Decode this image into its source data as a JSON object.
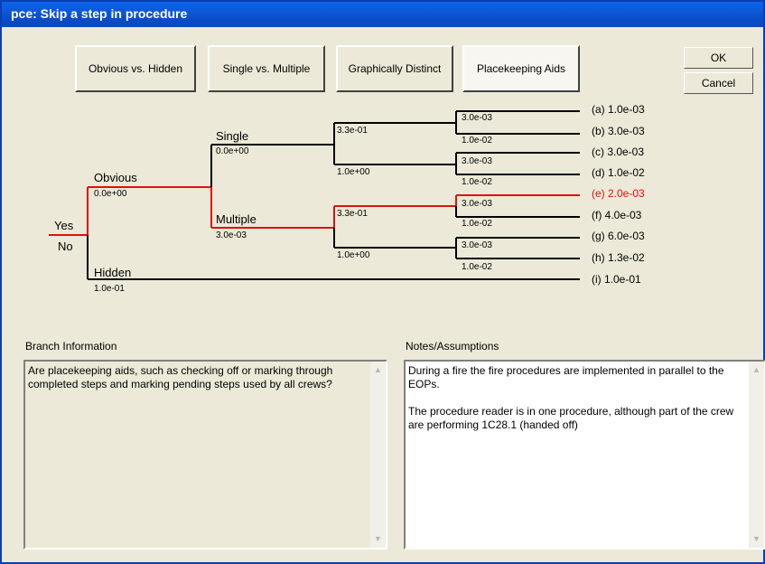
{
  "window": {
    "title": "pce: Skip a step in procedure"
  },
  "tabs": [
    {
      "label": "Obvious vs. Hidden",
      "selected": false
    },
    {
      "label": "Single vs. Multiple",
      "selected": false
    },
    {
      "label": "Graphically Distinct",
      "selected": false
    },
    {
      "label": "Placekeeping Aids",
      "selected": true
    }
  ],
  "buttons": {
    "ok": "OK",
    "cancel": "Cancel"
  },
  "tree": {
    "root": {
      "yes": "Yes",
      "no": "No"
    },
    "level1": [
      {
        "label": "Obvious",
        "value": "0.0e+00"
      },
      {
        "label": "Hidden",
        "value": "1.0e-01"
      }
    ],
    "level2": [
      {
        "label": "Single",
        "value": "0.0e+00"
      },
      {
        "label": "Multiple",
        "value": "3.0e-03"
      }
    ],
    "level3": [
      "3.3e-01",
      "1.0e+00",
      "3.3e-01",
      "1.0e+00"
    ],
    "level4": [
      "3.0e-03",
      "1.0e-02",
      "3.0e-03",
      "1.0e-02",
      "3.0e-03",
      "1.0e-02",
      "3.0e-03",
      "1.0e-02"
    ],
    "outcomes": [
      {
        "label": "(a) 1.0e-03",
        "highlight": false
      },
      {
        "label": "(b) 3.0e-03",
        "highlight": false
      },
      {
        "label": "(c) 3.0e-03",
        "highlight": false
      },
      {
        "label": "(d) 1.0e-02",
        "highlight": false
      },
      {
        "label": "(e) 2.0e-03",
        "highlight": true
      },
      {
        "label": "(f) 4.0e-03",
        "highlight": false
      },
      {
        "label": "(g) 6.0e-03",
        "highlight": false
      },
      {
        "label": "(h) 1.3e-02",
        "highlight": false
      },
      {
        "label": "(i) 1.0e-01",
        "highlight": false
      }
    ],
    "colors": {
      "line": "#000000",
      "path": "#e01010"
    }
  },
  "branch_info": {
    "title": "Branch Information",
    "text": "Are placekeeping aids, such as checking off or marking through completed steps and marking pending steps used by all crews?"
  },
  "notes": {
    "title": "Notes/Assumptions",
    "text": "During a fire the fire procedures are implemented in parallel to the EOPs.\n\nThe procedure reader is in one procedure, although part of the crew are performing 1C28.1 (handed off)"
  }
}
